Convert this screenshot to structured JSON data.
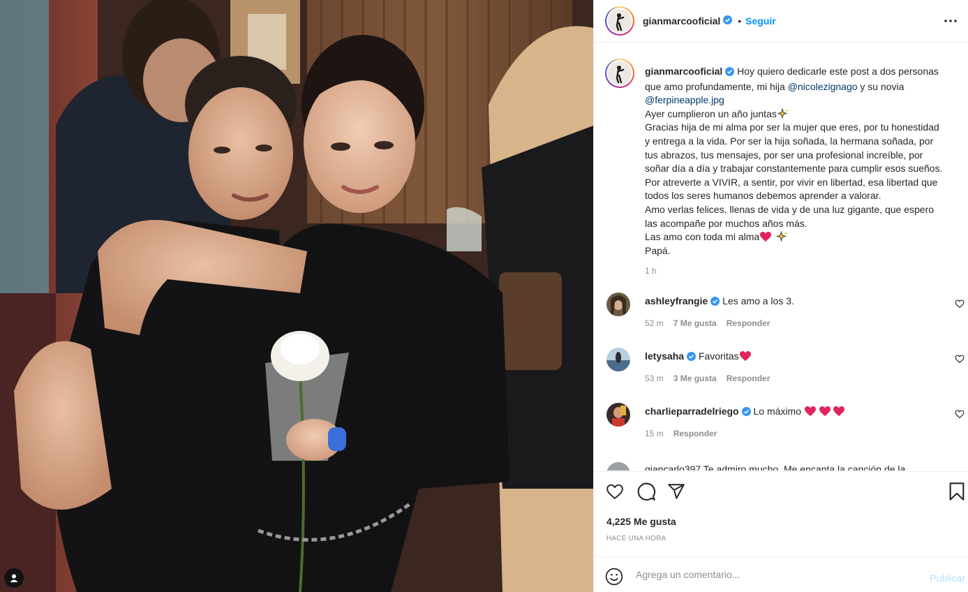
{
  "post": {
    "author": "gianmarcooficial",
    "follow_label": "Seguir",
    "dot": "•",
    "caption": {
      "line1_a": "Hoy quiero dedicarle este post a dos personas",
      "line2_a": "que amo profundamente, mi hija ",
      "mention1": "@nicolezignago",
      "line2_b": " y su novia",
      "mention2": "@ferpineapple.jpg",
      "line4": "Ayer cumplieron un año juntas",
      "line5": "Gracias hija de mi alma por ser la mujer que eres, por tu honestidad",
      "line6": "y entrega a la vida. Por ser la hija soñada, la hermana soñada, por",
      "line7": "tus abrazos, tus mensajes, por ser una profesional increíble, por",
      "line8": "soñar día a día y trabajar constantemente para cumplir esos sueños.",
      "line9": "Por atreverte a VIVIR, a sentir, por vivir en libertad, esa libertad que",
      "line10": "todos los seres humanos debemos aprender a valorar.",
      "line11": "Amo verlas felices, llenas de vida y de una luz gigante, que espero",
      "line12": "las acompañe por muchos años más.",
      "line13": "Las amo con toda mi alma",
      "line14": "Papá.",
      "time": "1 h"
    },
    "comments": [
      {
        "user": "ashleyfrangie",
        "text": "Les amo a los 3.",
        "time": "52 m",
        "likes": "7 Me gusta",
        "reply": "Responder"
      },
      {
        "user": "letysaha",
        "text": "Favoritas",
        "time": "53 m",
        "likes": "3 Me gusta",
        "reply": "Responder"
      },
      {
        "user": "charlieparradelriego",
        "text": "Lo máximo",
        "time": "15 m",
        "reply": "Responder"
      }
    ],
    "partial_comment": "giancarlo397 Te admiro mucho. Me encanta la canción de la",
    "likes": "4,225 Me gusta",
    "age": "HACE UNA HORA",
    "comment_placeholder": "Agrega un comentario...",
    "publish_label": "Publicar"
  },
  "colors": {
    "link": "#0095f6",
    "mention": "#00376b",
    "muted": "#8e8e8e",
    "verified": "#3897f0",
    "heart": "#e0245e"
  },
  "icons": [
    "verified-badge-icon",
    "more-options-icon",
    "heart-icon",
    "comment-icon",
    "share-icon",
    "bookmark-icon",
    "emoji-icon",
    "user-tag-icon",
    "sparkles-icon"
  ]
}
